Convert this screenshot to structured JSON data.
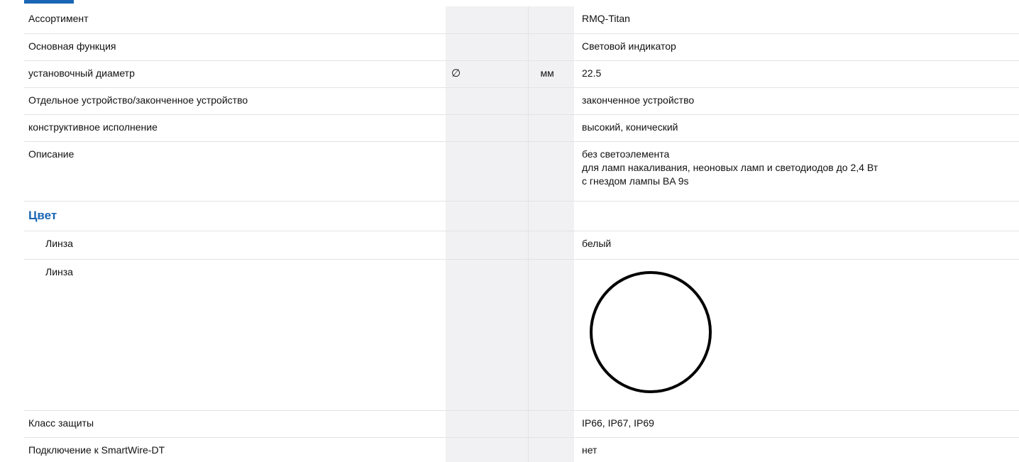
{
  "rows": [
    {
      "label": "Ассортимент",
      "symbol": "",
      "unit": "",
      "value": "RMQ-Titan"
    },
    {
      "label": "Основная функция",
      "symbol": "",
      "unit": "",
      "value": "Световой индикатор"
    },
    {
      "label": "установочный диаметр",
      "symbol": "∅",
      "unit": "мм",
      "value": "22.5"
    },
    {
      "label": "Отдельное устройство/законченное устройство",
      "symbol": "",
      "unit": "",
      "value": "законченное устройство"
    },
    {
      "label": "конструктивное исполнение",
      "symbol": "",
      "unit": "",
      "value": "высокий, конический"
    },
    {
      "label": "Описание",
      "symbol": "",
      "unit": "",
      "value_lines": [
        "без светоэлемента",
        "для ламп накаливания, неоновых ламп и светодиодов до 2,4 Вт",
        "с гнездом лампы BA 9s"
      ]
    }
  ],
  "color_section": {
    "title": "Цвет",
    "lens_label": "Линза",
    "lens_value": "белый",
    "lens_image_label": "Линза",
    "lens_icon": "white-circle-icon"
  },
  "bottom_rows": [
    {
      "label": "Класс защиты",
      "value": "IP66, IP67, IP69"
    },
    {
      "label": "Подключение к SmartWire-DT",
      "value": "нет"
    }
  ],
  "colors": {
    "accent": "#1a66b5",
    "shaded_column": "#f1f1f3",
    "divider": "#e3e3e3"
  }
}
